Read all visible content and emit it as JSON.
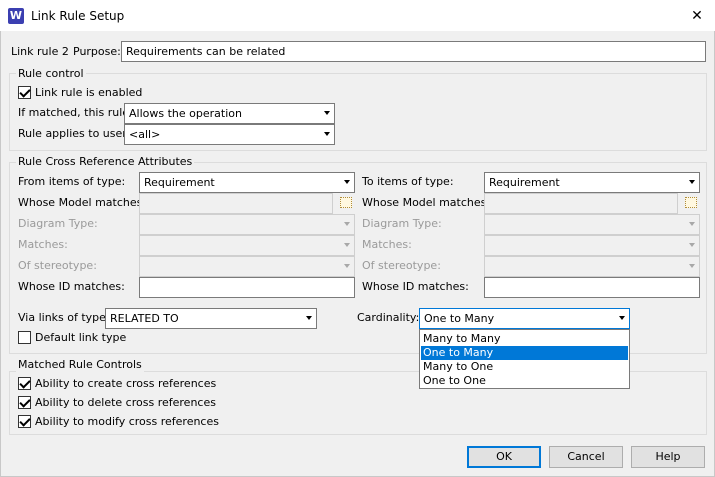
{
  "window": {
    "title": "Link Rule Setup",
    "app_icon_letter": "W"
  },
  "header": {
    "rule_label": "Link rule 2",
    "purpose_label": "Purpose:",
    "purpose_value": "Requirements can be related"
  },
  "rule_control": {
    "legend": "Rule control",
    "enabled_label": "Link rule is enabled",
    "enabled_checked": true,
    "if_matched_label": "If matched, this rule:",
    "if_matched_value": "Allows the operation",
    "applies_label": "Rule applies to user:",
    "applies_value": "<all>"
  },
  "cross_ref": {
    "legend": "Rule Cross Reference Attributes",
    "from": {
      "type_label": "From items of type:",
      "type_value": "Requirement",
      "model_label": "Whose Model matches:",
      "diagram_label": "Diagram Type:",
      "matches_label": "Matches:",
      "stereo_label": "Of stereotype:",
      "id_label": "Whose ID matches:"
    },
    "to": {
      "type_label": "To items of type:",
      "type_value": "Requirement",
      "model_label": "Whose Model matches:",
      "diagram_label": "Diagram Type:",
      "matches_label": "Matches:",
      "stereo_label": "Of stereotype:",
      "id_label": "Whose ID matches:"
    },
    "via_label": "Via links of type:",
    "via_value": "RELATED TO",
    "default_link_label": "Default link type",
    "default_link_checked": false,
    "cardinality_label": "Cardinality:",
    "cardinality_value": "One to Many",
    "cardinality_options": [
      "Many to Many",
      "One to Many",
      "Many to One",
      "One to One"
    ],
    "cardinality_selected_index": 1
  },
  "matched": {
    "legend": "Matched Rule Controls",
    "items": [
      {
        "label": "Ability to create cross references",
        "checked": true
      },
      {
        "label": "Ability to delete cross references",
        "checked": true
      },
      {
        "label": "Ability to modify cross references",
        "checked": true
      }
    ]
  },
  "buttons": {
    "ok": "OK",
    "cancel": "Cancel",
    "help": "Help"
  },
  "colors": {
    "accent": "#0078d7",
    "icon_bg": "#3b3fb1",
    "disabled_text": "#9a9a9a"
  },
  "icons": {
    "close": "close-icon",
    "browse": "browse-icon",
    "dropdown": "chevron-down-icon"
  }
}
